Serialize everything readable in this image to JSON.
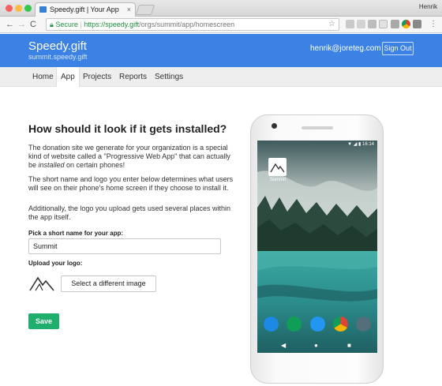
{
  "browser": {
    "tab_title": "Speedy.gift | Your App",
    "user_name": "Henrik",
    "url_secure_label": "Secure",
    "url_scheme_host": "https://speedy.gift",
    "url_path": "/orgs/summit/app/homescreen",
    "nav": {
      "back": "←",
      "forward": "→",
      "reload": "C",
      "star": "☆",
      "tab_close": "×"
    }
  },
  "header": {
    "brand": "Speedy.gift",
    "subdomain": "summit.speedy.gift",
    "email": "henrik@joreteg.com",
    "signout_label": "Sign Out"
  },
  "nav": {
    "tabs": [
      {
        "label": "Home"
      },
      {
        "label": "App",
        "active": true
      },
      {
        "label": "Projects"
      },
      {
        "label": "Reports"
      },
      {
        "label": "Settings"
      }
    ]
  },
  "main": {
    "heading": "How should it look if it gets installed?",
    "para1_a": "The donation site we generate for your organization is a special kind of website called a \"Progressive Web App\" that can actually be ",
    "para1_em": "installed",
    "para1_b": " on certain phones!",
    "para2": "The short name and logo you enter below determines what users will see on their phone's home screen if they choose to install it.",
    "para3": "Additionally, the logo you upload gets used several places within the app itself.",
    "short_name_label": "Pick a short name for your app:",
    "short_name_value": "Summit",
    "logo_label": "Upload your logo:",
    "change_image_label": "Select a different image",
    "save_label": "Save"
  },
  "phone": {
    "status_time": "16:14",
    "app_label": "Summit",
    "nav_back": "◀",
    "nav_home": "●",
    "nav_recent": "■"
  },
  "colors": {
    "header_blue": "#3b82e4",
    "save_green": "#1fae6b",
    "secure_green": "#1e8e3e"
  }
}
